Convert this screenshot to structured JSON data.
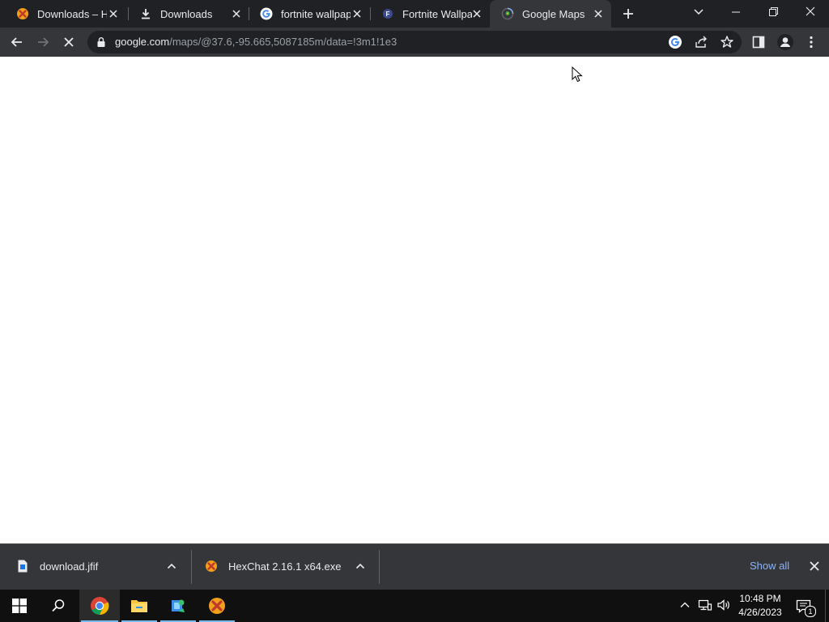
{
  "tabs": [
    {
      "label": "Downloads – He",
      "icon": "hexchat-icon",
      "active": false
    },
    {
      "label": "Downloads",
      "icon": "download-icon",
      "active": false
    },
    {
      "label": "fortnite wallpap",
      "icon": "google-icon",
      "active": false
    },
    {
      "label": "Fortnite Wallpap",
      "icon": "fortnite-site-icon",
      "active": false
    },
    {
      "label": "Google Maps",
      "icon": "google-maps-icon",
      "active": true
    }
  ],
  "address_bar": {
    "host": "google.com",
    "path": "/maps/@37.6,-95.665,5087185m/data=!3m1!1e3"
  },
  "downloads": [
    {
      "name": "download.jfif",
      "icon": "file-icon"
    },
    {
      "name": "HexChat 2.16.1 x64.exe",
      "icon": "hexchat-icon"
    }
  ],
  "downloads_bar": {
    "show_all_label": "Show all"
  },
  "taskbar": {
    "apps": [
      "start-icon",
      "search-icon",
      "chrome-icon",
      "file-explorer-icon",
      "network-app-icon",
      "hexchat-icon"
    ],
    "time": "10:48 PM",
    "date": "4/26/2023",
    "notification_count": "1"
  },
  "colors": {
    "tabstrip": "#202124",
    "toolbar": "#35363a",
    "link": "#8ab4f8",
    "taskbar": "#101010"
  }
}
